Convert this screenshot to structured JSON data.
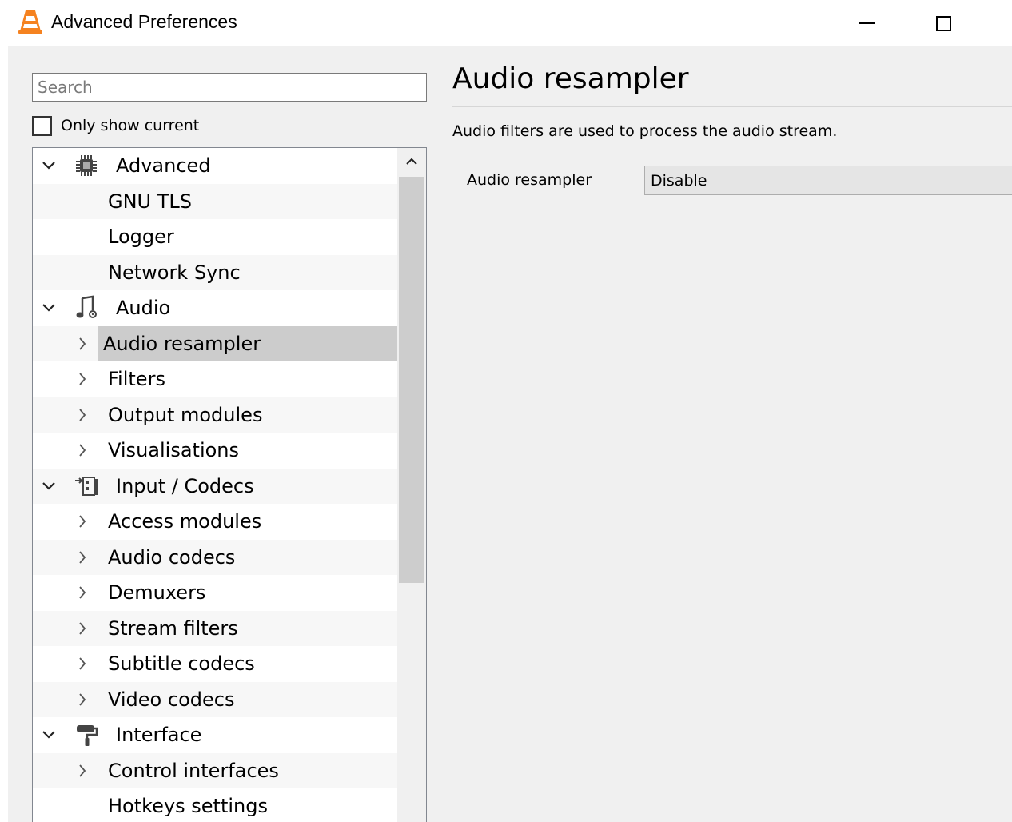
{
  "window": {
    "title": "Advanced Preferences"
  },
  "search": {
    "placeholder": "Search"
  },
  "only_show_current": {
    "label": "Only show current",
    "checked": false
  },
  "tree": {
    "rows": [
      {
        "label": "Advanced",
        "level": 0,
        "toggle": "expanded",
        "icon": "chip-icon"
      },
      {
        "label": "GNU TLS",
        "level": 1,
        "toggle": "none"
      },
      {
        "label": "Logger",
        "level": 1,
        "toggle": "none"
      },
      {
        "label": "Network Sync",
        "level": 1,
        "toggle": "none"
      },
      {
        "label": "Audio",
        "level": 0,
        "toggle": "expanded",
        "icon": "music-note-icon"
      },
      {
        "label": "Audio resampler",
        "level": 1,
        "toggle": "collapsed",
        "selected": true
      },
      {
        "label": "Filters",
        "level": 1,
        "toggle": "collapsed"
      },
      {
        "label": "Output modules",
        "level": 1,
        "toggle": "collapsed"
      },
      {
        "label": "Visualisations",
        "level": 1,
        "toggle": "collapsed"
      },
      {
        "label": "Input / Codecs",
        "level": 0,
        "toggle": "expanded",
        "icon": "input-codecs-icon"
      },
      {
        "label": "Access modules",
        "level": 1,
        "toggle": "collapsed"
      },
      {
        "label": "Audio codecs",
        "level": 1,
        "toggle": "collapsed"
      },
      {
        "label": "Demuxers",
        "level": 1,
        "toggle": "collapsed"
      },
      {
        "label": "Stream filters",
        "level": 1,
        "toggle": "collapsed"
      },
      {
        "label": "Subtitle codecs",
        "level": 1,
        "toggle": "collapsed"
      },
      {
        "label": "Video codecs",
        "level": 1,
        "toggle": "collapsed"
      },
      {
        "label": "Interface",
        "level": 0,
        "toggle": "expanded",
        "icon": "paint-roller-icon"
      },
      {
        "label": "Control interfaces",
        "level": 1,
        "toggle": "collapsed"
      },
      {
        "label": "Hotkeys settings",
        "level": 1,
        "toggle": "none"
      }
    ]
  },
  "panel": {
    "title": "Audio resampler",
    "description": "Audio filters are used to process the audio stream.",
    "option_label": "Audio resampler",
    "option_value": "Disable"
  },
  "colors": {
    "selected_row": "#cccccc",
    "accent_cone": "#f58220",
    "client_bg": "#f0f0f0"
  }
}
